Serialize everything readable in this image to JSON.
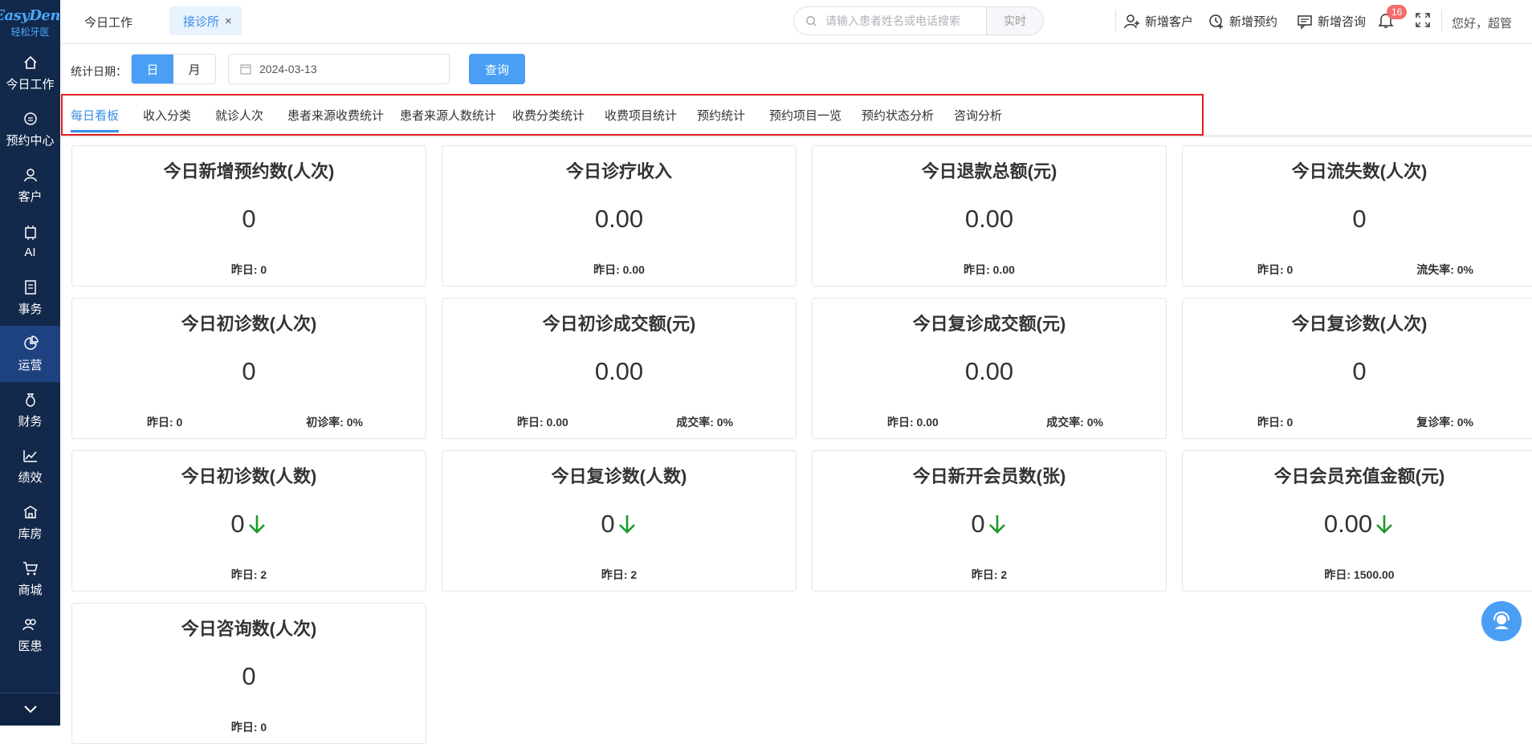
{
  "sidebar": {
    "logo_en": "EasyDent",
    "logo_cn": "轻松牙医",
    "items": [
      {
        "label": "今日工作",
        "icon": "home-icon"
      },
      {
        "label": "预约中心",
        "icon": "calendar-icon"
      },
      {
        "label": "客户",
        "icon": "user-icon"
      },
      {
        "label": "AI",
        "icon": "ai-chip-icon"
      },
      {
        "label": "事务",
        "icon": "document-icon"
      },
      {
        "label": "运营",
        "icon": "pie-chart-icon",
        "active": true
      },
      {
        "label": "财务",
        "icon": "money-bag-icon"
      },
      {
        "label": "绩效",
        "icon": "trend-icon"
      },
      {
        "label": "库房",
        "icon": "warehouse-icon"
      },
      {
        "label": "商城",
        "icon": "cart-icon"
      },
      {
        "label": "医患",
        "icon": "people-icon"
      }
    ]
  },
  "topbar": {
    "tab_today": "今日工作",
    "tab_active": "接诊所",
    "search_placeholder": "请输入患者姓名或电话搜索",
    "realtime": "实时",
    "actions": {
      "new_customer": "新增客户",
      "new_appointment": "新增预约",
      "new_consult": "新增咨询"
    },
    "notification_count": "16",
    "greeting": "您好，超管"
  },
  "filter": {
    "label": "统计日期：",
    "day": "日",
    "month": "月",
    "date": "2024-03-13",
    "query": "查询"
  },
  "stat_tabs": [
    "每日看板",
    "收入分类",
    "就诊人次",
    "患者来源收费统计",
    "患者来源人数统计",
    "收费分类统计",
    "收费项目统计",
    "预约统计",
    "预约项目一览",
    "预约状态分析",
    "咨询分析"
  ],
  "cards": [
    {
      "title": "今日新增预约数(人次)",
      "value": "0",
      "yesterday": "昨日: 0"
    },
    {
      "title": "今日诊疗收入",
      "value": "0.00",
      "yesterday": "昨日: 0.00"
    },
    {
      "title": "今日退款总额(元)",
      "value": "0.00",
      "yesterday": "昨日: 0.00"
    },
    {
      "title": "今日流失数(人次)",
      "value": "0",
      "yesterday": "昨日: 0",
      "rate": "流失率: 0%"
    },
    {
      "title": "今日初诊数(人次)",
      "value": "0",
      "yesterday": "昨日: 0",
      "rate": "初诊率: 0%"
    },
    {
      "title": "今日初诊成交额(元)",
      "value": "0.00",
      "yesterday": "昨日: 0.00",
      "rate": "成交率: 0%"
    },
    {
      "title": "今日复诊成交额(元)",
      "value": "0.00",
      "yesterday": "昨日: 0.00",
      "rate": "成交率: 0%"
    },
    {
      "title": "今日复诊数(人次)",
      "value": "0",
      "yesterday": "昨日: 0",
      "rate": "复诊率: 0%"
    },
    {
      "title": "今日初诊数(人数)",
      "value": "0",
      "yesterday": "昨日: 2",
      "trend": "down"
    },
    {
      "title": "今日复诊数(人数)",
      "value": "0",
      "yesterday": "昨日: 2",
      "trend": "down"
    },
    {
      "title": "今日新开会员数(张)",
      "value": "0",
      "yesterday": "昨日: 2",
      "trend": "down"
    },
    {
      "title": "今日会员充值金额(元)",
      "value": "0.00",
      "yesterday": "昨日: 1500.00",
      "trend": "down"
    },
    {
      "title": "今日咨询数(人次)",
      "value": "0",
      "yesterday": "昨日: 0"
    }
  ],
  "colors": {
    "sidebar": "#13294b",
    "accent": "#3a8ee6",
    "down_arrow": "#1a9a2a",
    "highlight_box": "#e02020"
  }
}
